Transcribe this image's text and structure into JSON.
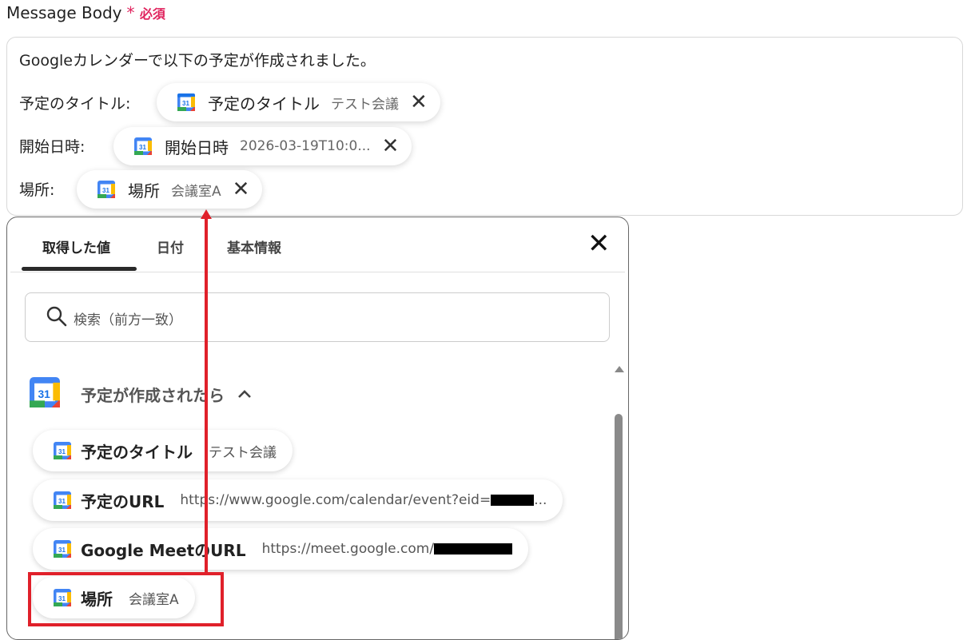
{
  "field": {
    "label": "Message Body",
    "required_mark": "*",
    "required_text": "必須"
  },
  "editor": {
    "intro": "Googleカレンダーで以下の予定が作成されました。",
    "rows": [
      {
        "label": "予定のタイトル:",
        "chip_name": "予定のタイトル",
        "chip_value": "テスト会議"
      },
      {
        "label": "開始日時:",
        "chip_name": "開始日時",
        "chip_value": "2026-03-19T10:0..."
      },
      {
        "label": "場所:",
        "chip_name": "場所",
        "chip_value": "会議室A"
      }
    ],
    "chip_remove_icon": "close-icon"
  },
  "panel": {
    "tabs": [
      {
        "label": "取得した値",
        "active": true
      },
      {
        "label": "日付",
        "active": false
      },
      {
        "label": "基本情報",
        "active": false
      }
    ],
    "search_placeholder": "検索（前方一致）",
    "group": {
      "title": "予定が作成されたら",
      "expanded": true,
      "icon": "google-calendar-icon"
    },
    "items": [
      {
        "name": "予定のタイトル",
        "value": "テスト会議"
      },
      {
        "name": "予定のURL",
        "value": "https://www.google.com/calendar/event?eid=",
        "redacted": true,
        "value_suffix": "..."
      },
      {
        "name": "Google MeetのURL",
        "value": "https://meet.google.com/",
        "redacted": true
      },
      {
        "name": "場所",
        "value": "会議室A",
        "highlighted": true
      }
    ]
  },
  "colors": {
    "required": "#e0245e",
    "highlight": "#e0202a"
  }
}
